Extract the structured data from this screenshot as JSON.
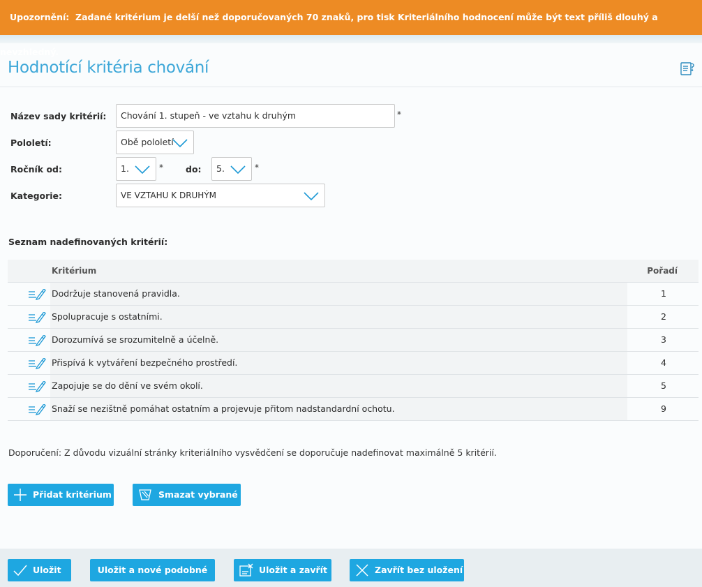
{
  "warning": {
    "prefix": "Upozornění:",
    "text": "Zadané kritérium je delší než doporučovaných 70 znaků, pro tisk Kriteriálního hodnocení může být text příliš dlouhý a nevzhledný."
  },
  "page": {
    "title": "Hodnotící kritéria chování",
    "help_icon": "help-document-icon"
  },
  "form": {
    "name_label": "Název sady kritérií:",
    "name_value": "Chování 1. stupeň - ve vztahu k druhým",
    "semester_label": "Pololetí:",
    "semester_value": "Obě pololetí",
    "grade_from_label": "Ročník od:",
    "grade_from_value": "1.",
    "grade_to_label": "do:",
    "grade_to_value": "5.",
    "category_label": "Kategorie:",
    "category_value": "VE VZTAHU K DRUHÝM",
    "required_mark": "*"
  },
  "criteria": {
    "section_title": "Seznam nadefinovaných kritérií:",
    "columns": {
      "criterion": "Kritérium",
      "order": "Pořadí"
    },
    "rows": [
      {
        "text": "Dodržuje stanovená pravidla.",
        "order": "1"
      },
      {
        "text": "Spolupracuje s ostatními.",
        "order": "2"
      },
      {
        "text": "Dorozumívá se srozumitelně a účelně.",
        "order": "3"
      },
      {
        "text": "Přispívá k vytváření bezpečného prostředí.",
        "order": "4"
      },
      {
        "text": "Zapojuje se do dění ve svém okolí.",
        "order": "5"
      },
      {
        "text": "Snaží se nezištně pomáhat ostatním a projevuje přitom nadstandardní ochotu.",
        "order": "9"
      }
    ]
  },
  "recommendation": "Doporučení: Z důvodu vizuální stránky kriteriálního vysvědčení se doporučuje nadefinovat maximálně 5 kritérií.",
  "actions": {
    "add": "Přidat kritérium",
    "delete": "Smazat vybrané",
    "save": "Uložit",
    "save_new": "Uložit a nové podobné",
    "save_close": "Uložit a zavřít",
    "close": "Zavřít bez uložení"
  },
  "colors": {
    "accent": "#1ea7e1",
    "warning": "#ed8b24",
    "title": "#3da7d8"
  }
}
